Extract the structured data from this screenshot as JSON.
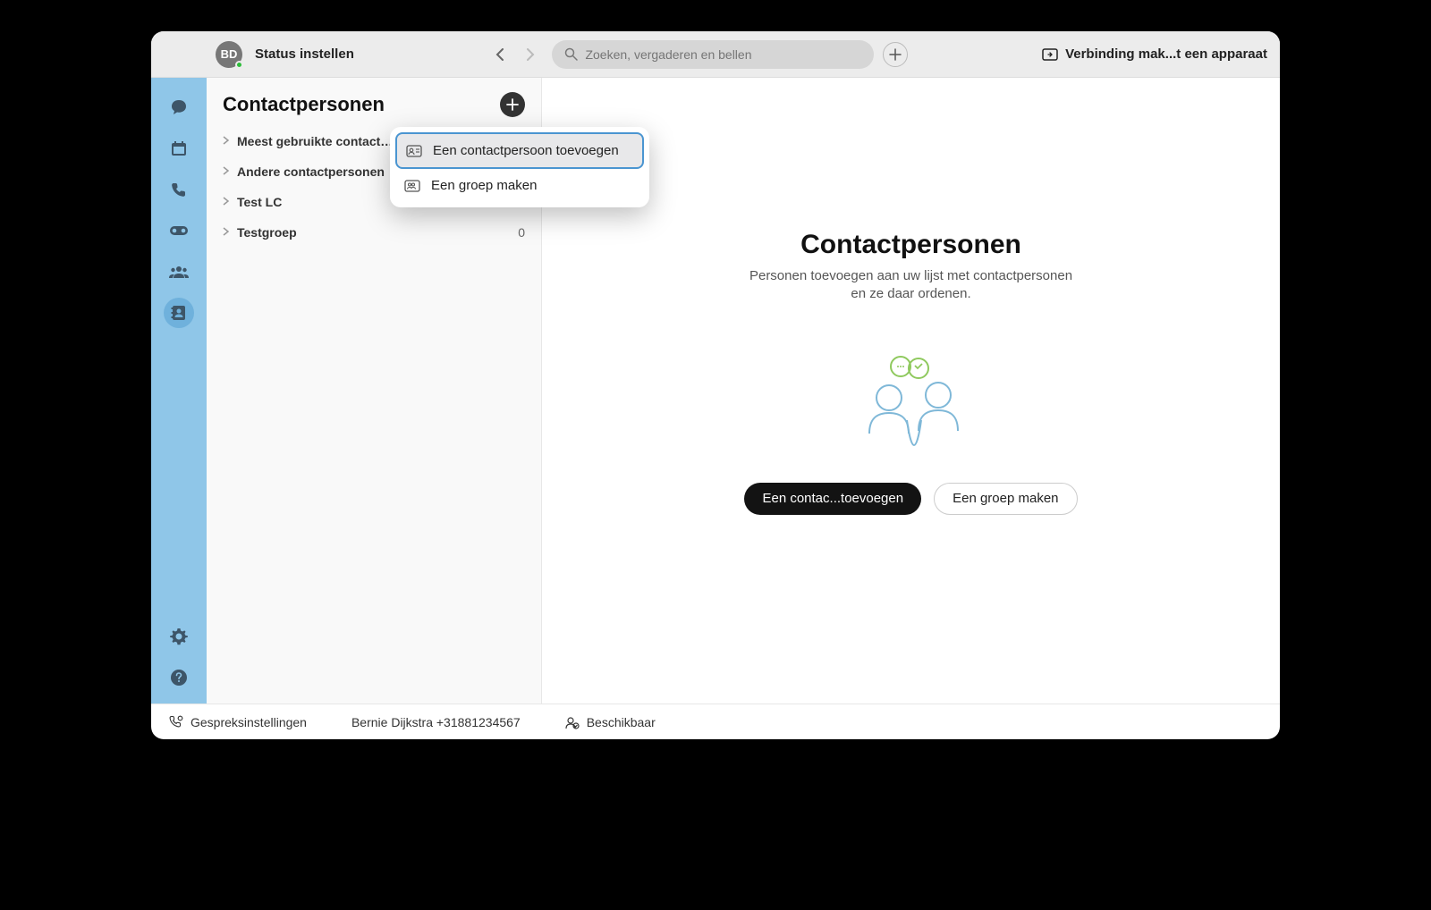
{
  "header": {
    "avatar_initials": "BD",
    "status_label": "Status instellen",
    "search_placeholder": "Zoeken, vergaderen en bellen",
    "device_label": "Verbinding mak...t een apparaat"
  },
  "sidebar": {
    "title": "Contactpersonen",
    "groups": [
      {
        "name": "Meest gebruikte contactpers",
        "count": ""
      },
      {
        "name": "Andere contactpersonen",
        "count": ""
      },
      {
        "name": "Test LC",
        "count": ""
      },
      {
        "name": "Testgroep",
        "count": "0"
      }
    ]
  },
  "popup": {
    "add_contact": "Een contactpersoon toevoegen",
    "create_group": "Een groep maken"
  },
  "main": {
    "heading": "Contactpersonen",
    "subtext": "Personen toevoegen aan uw lijst met contactpersonen en ze daar ordenen.",
    "primary_btn": "Een contac...toevoegen",
    "secondary_btn": "Een groep maken"
  },
  "footer": {
    "call_settings": "Gespreksinstellingen",
    "user_line": "Bernie Dijkstra +31881234567",
    "availability": "Beschikbaar"
  }
}
